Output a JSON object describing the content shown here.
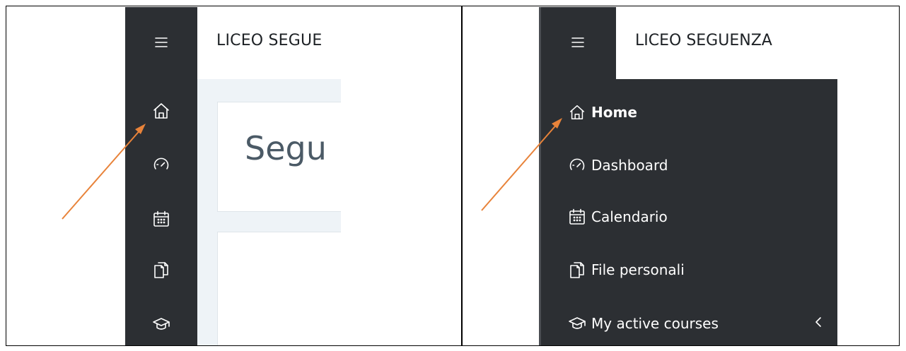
{
  "left_panel": {
    "site_title": "LICEO SEGUE",
    "course_title": "Segu",
    "rail_icons": [
      "home-icon",
      "dashboard-icon",
      "calendar-icon",
      "files-icon",
      "courses-icon"
    ]
  },
  "right_panel": {
    "site_title": "LICEO SEGUENZA",
    "nav": [
      {
        "label": "Home",
        "icon": "home-icon"
      },
      {
        "label": "Dashboard",
        "icon": "dashboard-icon"
      },
      {
        "label": "Calendario",
        "icon": "calendar-icon"
      },
      {
        "label": "File personali",
        "icon": "files-icon"
      },
      {
        "label": "My active courses",
        "icon": "courses-icon"
      }
    ]
  },
  "colors": {
    "rail": "#2c2f33",
    "arrow": "#e8833a",
    "content_bg": "#eef3f7",
    "course_text": "#4b5a66"
  }
}
